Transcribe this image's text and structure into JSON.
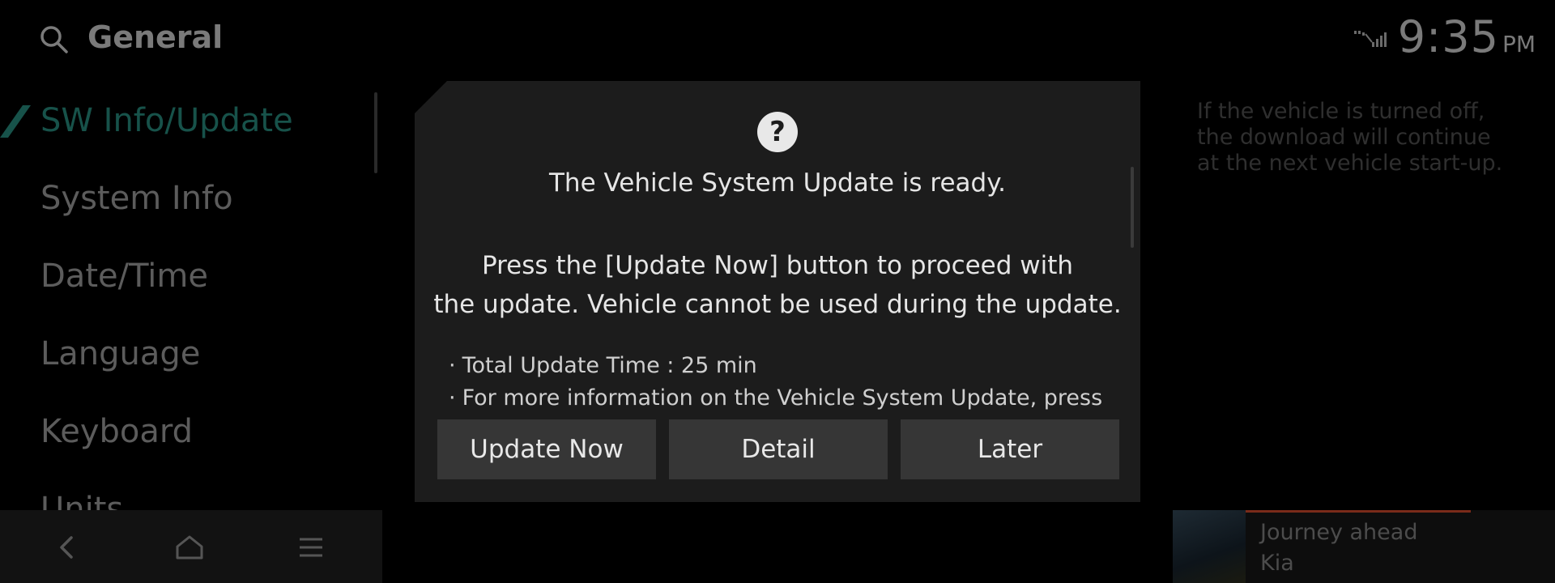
{
  "header": {
    "title": "General",
    "search_icon": "search-icon",
    "status_icon": "signal-icon",
    "time": "9:35",
    "ampm": "PM"
  },
  "sidebar": {
    "items": [
      {
        "label": "SW Info/Update",
        "active": true
      },
      {
        "label": "System Info"
      },
      {
        "label": "Date/Time"
      },
      {
        "label": "Language"
      },
      {
        "label": "Keyboard"
      },
      {
        "label": "Units"
      }
    ]
  },
  "info_panel": {
    "text": "If the vehicle is turned off,\nthe download will continue\nat the next vehicle start-up."
  },
  "navbar": {
    "back_icon": "back-icon",
    "home_icon": "home-icon",
    "menu_icon": "menu-icon"
  },
  "media": {
    "title": "Journey ahead",
    "artist": "Kia"
  },
  "dialog": {
    "icon": "question-icon",
    "icon_glyph": "?",
    "title": "The Vehicle System Update is ready.",
    "message": "Press the [Update Now] button to proceed with\nthe update. Vehicle cannot be used during the update.",
    "bullets": [
      "Total Update Time : 25 min",
      "For more information on the Vehicle System Update, press"
    ],
    "buttons": {
      "update_now": "Update Now",
      "detail": "Detail",
      "later": "Later"
    }
  },
  "colors": {
    "background": "#000000",
    "dialog": "#1c1c1c",
    "button": "#363636",
    "active_accent": "#17524a",
    "media_progress": "#7a2b1a"
  }
}
